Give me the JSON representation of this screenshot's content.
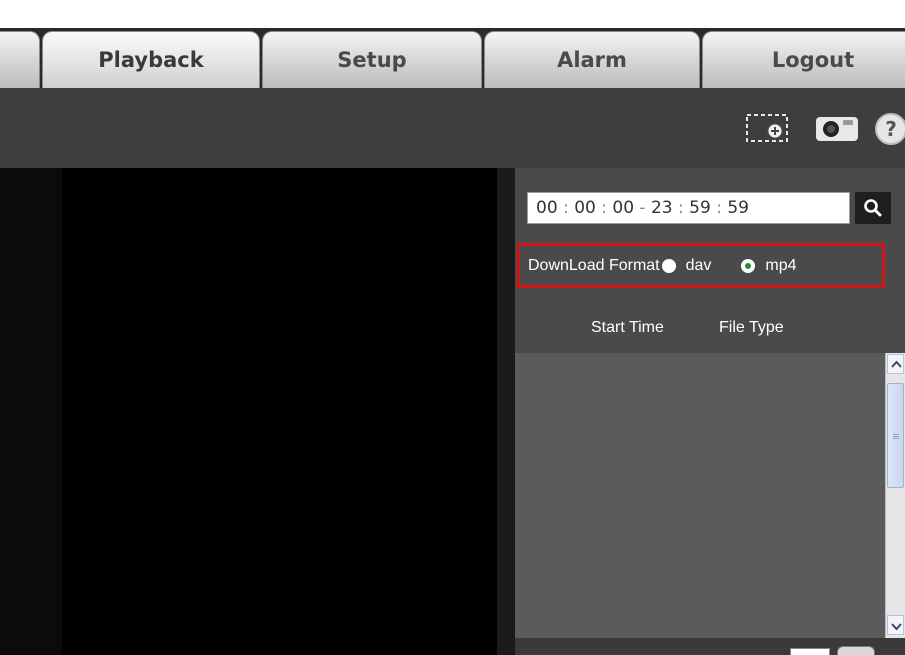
{
  "tabs": [
    {
      "label": ""
    },
    {
      "label": "Playback",
      "active": true
    },
    {
      "label": "Setup"
    },
    {
      "label": "Alarm"
    },
    {
      "label": "Logout"
    }
  ],
  "toolbar": {
    "icons": [
      "zoom-in-icon",
      "snapshot-icon",
      "help-icon"
    ]
  },
  "search": {
    "start_hh": "00",
    "start_mm": "00",
    "start_ss": "00",
    "dash": "-",
    "end_hh": "23",
    "end_mm": "59",
    "end_ss": "59",
    "sep": ":",
    "button_icon": "search-icon"
  },
  "download": {
    "label": "DownLoad Format",
    "options": [
      {
        "label": "dav",
        "checked": false
      },
      {
        "label": "mp4",
        "checked": true
      }
    ],
    "highlight_color": "#d41414"
  },
  "file_list": {
    "columns": [
      "Start Time",
      "File Type"
    ],
    "rows": []
  },
  "colors": {
    "tab_bar": "#2a2a2a",
    "toolbar": "#3e3e3e",
    "panel": "#4a4a4a",
    "video": "#000000"
  }
}
